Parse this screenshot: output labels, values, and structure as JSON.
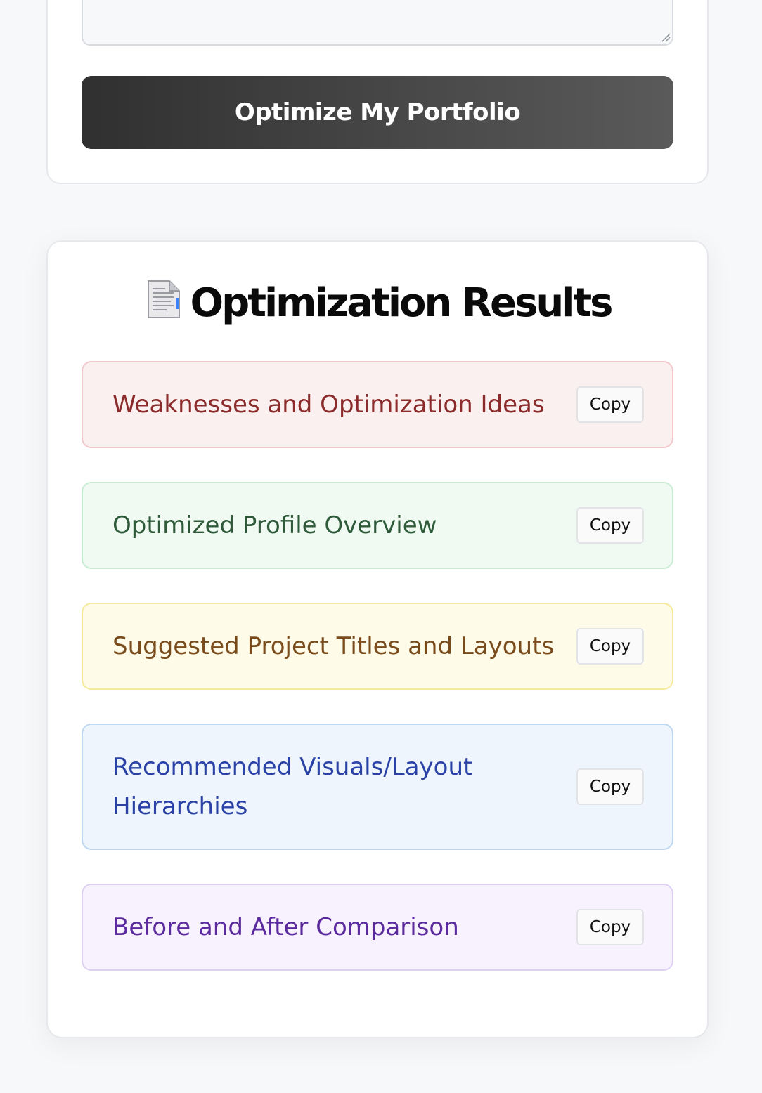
{
  "form": {
    "textarea_value": "",
    "submit_label": "Optimize My Portfolio"
  },
  "results": {
    "title_icon": "page-facing-up-icon",
    "title": "Optimization Results",
    "sections": [
      {
        "label": "Weaknesses and Optimization Ideas",
        "copy_label": "Copy",
        "color": "#8b2b2b"
      },
      {
        "label": "Optimized Profile Overview",
        "copy_label": "Copy",
        "color": "#2e5a3a"
      },
      {
        "label": "Suggested Project Titles and Layouts",
        "copy_label": "Copy",
        "color": "#7a4c1c"
      },
      {
        "label": "Recommended Visuals/Layout Hierarchies",
        "copy_label": "Copy",
        "color": "#2a42a6"
      },
      {
        "label": "Before and After Comparison",
        "copy_label": "Copy",
        "color": "#5b2a9e"
      }
    ]
  }
}
